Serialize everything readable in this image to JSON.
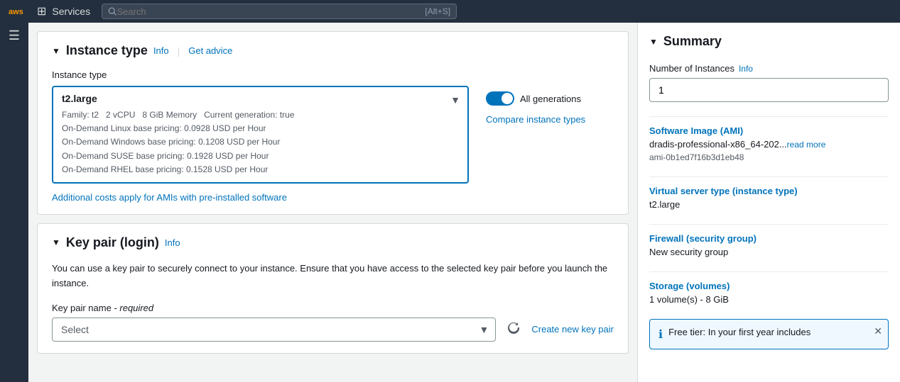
{
  "nav": {
    "aws_logo": "aws",
    "grid_icon": "⊞",
    "services_label": "Services",
    "search_placeholder": "Search",
    "search_hint": "[Alt+S]"
  },
  "sidebar": {
    "menu_icon": "☰"
  },
  "instance_type_section": {
    "collapse_icon": "▼",
    "title": "Instance type",
    "info_link": "Info",
    "advice_link": "Get advice",
    "field_label": "Instance type",
    "dropdown": {
      "selected_type": "t2.large",
      "family": "Family: t2",
      "vcpu": "2 vCPU",
      "memory": "8 GiB Memory",
      "generation": "Current generation: true",
      "linux_pricing": "On-Demand Linux base pricing: 0.0928 USD per Hour",
      "windows_pricing": "On-Demand Windows base pricing: 0.1208 USD per Hour",
      "suse_pricing": "On-Demand SUSE base pricing: 0.1928 USD per Hour",
      "rhel_pricing": "On-Demand RHEL base pricing: 0.1528 USD per Hour"
    },
    "all_generations_label": "All generations",
    "compare_link": "Compare instance types",
    "additional_costs_link": "Additional costs apply for AMIs with pre-installed software"
  },
  "key_pair_section": {
    "collapse_icon": "▼",
    "title": "Key pair (login)",
    "info_link": "Info",
    "description": "You can use a key pair to securely connect to your instance. Ensure that you have access to the selected key pair before you launch the instance.",
    "field_label": "Key pair name",
    "required_text": "required",
    "select_placeholder": "Select",
    "create_link": "Create new key pair"
  },
  "summary": {
    "collapse_icon": "▼",
    "title": "Summary",
    "instances_label": "Number of Instances",
    "instances_info_link": "Info",
    "instances_value": "1",
    "ami_label": "Software Image (AMI)",
    "ami_value": "dradis-professional-x86_64-202...",
    "ami_read_more": "read more",
    "ami_id": "ami-0b1ed7f16b3d1eb48",
    "instance_type_label": "Virtual server type (instance type)",
    "instance_type_value": "t2.large",
    "firewall_label": "Firewall (security group)",
    "firewall_value": "New security group",
    "storage_label": "Storage (volumes)",
    "storage_value": "1 volume(s) - 8 GiB",
    "free_tier_text": "Free tier: In your first year includes"
  }
}
